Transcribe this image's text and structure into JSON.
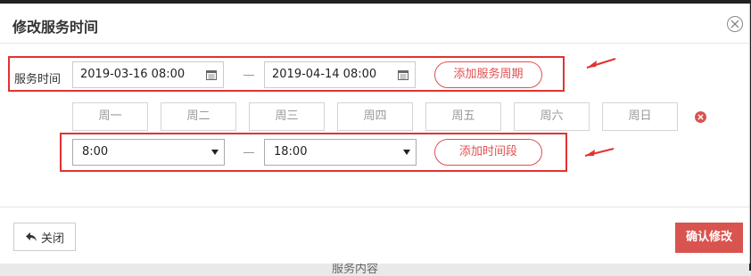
{
  "modal": {
    "title": "修改服务时间",
    "background_text": "服务内容"
  },
  "service_period": {
    "label": "服务时间",
    "start_date": "2019-03-16 08:00",
    "end_date": "2019-04-14 08:00",
    "add_button": "添加服务周期"
  },
  "weekdays": [
    "周一",
    "周二",
    "周三",
    "周四",
    "周五",
    "周六",
    "周日"
  ],
  "time_slot": {
    "start_time": "8:00",
    "end_time": "18:00",
    "add_button": "添加时间段"
  },
  "footer": {
    "close_label": "关闭",
    "confirm_label": "确认修改"
  },
  "colors": {
    "accent_red": "#d9534f",
    "annotation_red": "#e23232"
  }
}
